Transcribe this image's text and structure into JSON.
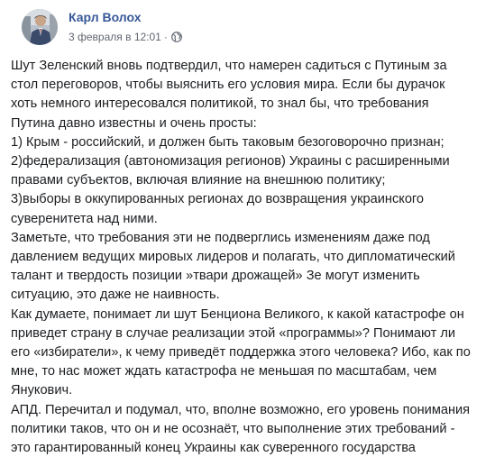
{
  "post": {
    "author": "Карл Волох",
    "date": "3 февраля в 12:01",
    "separator": "·",
    "privacy_icon": "globe-icon",
    "lines": [
      "Шут Зеленский вновь подтвердил, что намерен садиться с Путиным за",
      "стол переговоров, чтобы выяснить его условия мира. Если бы дурачок",
      "хоть немного интересовался политикой, то знал бы, что требования",
      "Путина давно известны и очень просты:",
      "1) Крым - российский, и должен быть таковым безоговорочно признан;",
      "2)федерализация (автономизация регионов) Украины с расширенными",
      "правами субъектов, включая влияние на внешнюю политику;",
      "3)выборы в оккупированных регионах до возвращения украинского",
      "суверенитета над ними.",
      "Заметьте, что требования эти не подверглись изменениям даже под",
      "давлением ведущих мировых лидеров и полагать, что дипломатический",
      "талант и твердость позиции »твари дрожащей» Зе могут изменить",
      "ситуацию, это даже не наивность.",
      "Как думаете, понимает ли шут Бенциона Великого, к какой катастрофе он",
      "приведет страну в случае реализации этой «программы»? Понимают ли",
      "его «избиратели», к чему приведёт поддержка этого человека? Ибо, как по",
      "мне, то нас может ждать катастрофа не меньшая по масштабам, чем",
      "Янукович.",
      "АПД. Перечитал и подумал, что, вполне возможно, его уровень понимания",
      "политики таков, что он и не осознаёт, что выполнение этих требований -",
      "это гарантированный конец Украины как суверенного государства"
    ]
  },
  "colors": {
    "author": "#385898",
    "meta": "#616770",
    "text": "#1c1e21"
  }
}
